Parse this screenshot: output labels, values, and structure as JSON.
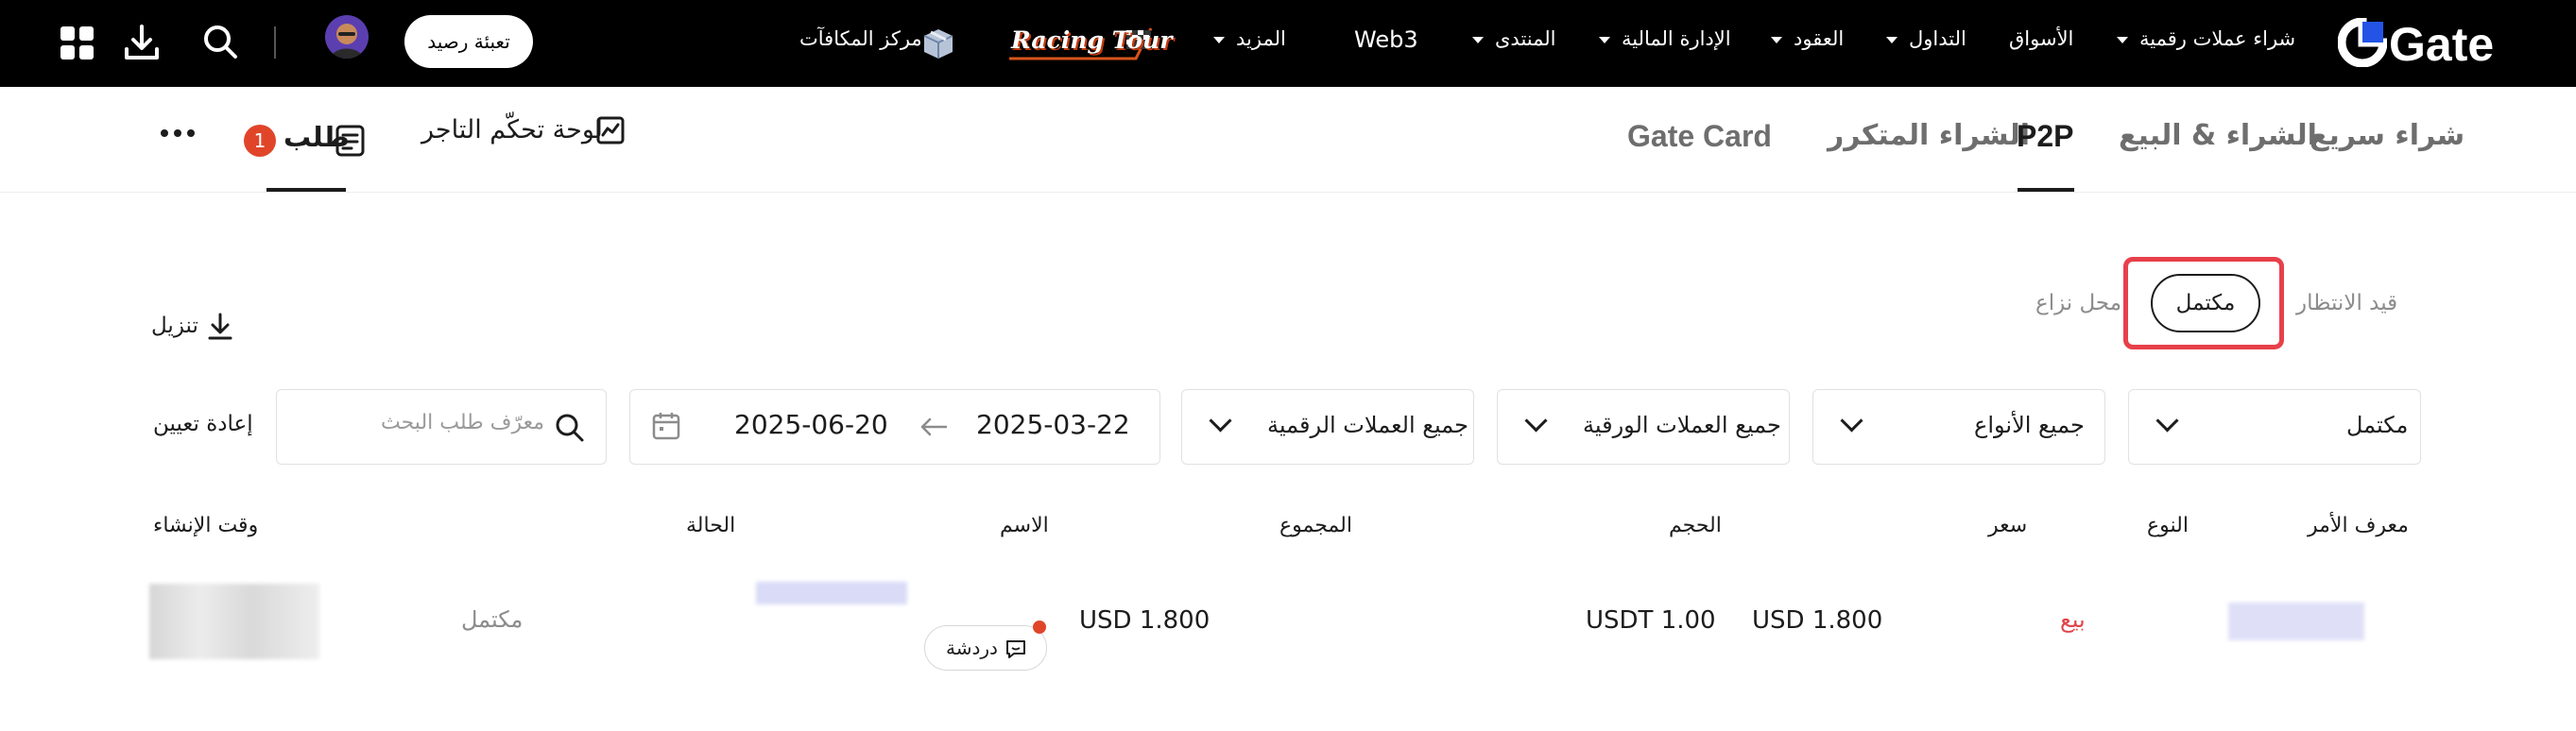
{
  "topnav": {
    "logo": "Gate",
    "items": [
      {
        "label": "شراء عملات رقمية",
        "dropdown": true
      },
      {
        "label": "الأسواق",
        "dropdown": false
      },
      {
        "label": "التداول",
        "dropdown": true
      },
      {
        "label": "العقود",
        "dropdown": true
      },
      {
        "label": "الإدارة المالية",
        "dropdown": true
      },
      {
        "label": "المنتدى",
        "dropdown": true
      },
      {
        "label": "Web3",
        "dropdown": false
      },
      {
        "label": "المزيد",
        "dropdown": true
      }
    ],
    "promo": "Racing Tour",
    "rewards": "مركز المكافآت",
    "topup_button": "تعبئة رصيد"
  },
  "subnav": {
    "tabs": [
      "شراء سريع",
      "الشراء & البيع",
      "P2P",
      "الشراء المتكرر",
      "Gate Card"
    ],
    "active_tab": "P2P",
    "merchant_dashboard": "لوحة تحكّم التاجر",
    "orders": "طلب",
    "orders_badge": "1"
  },
  "status_tabs": {
    "pending": "قيد الانتظار",
    "completed": "مكتمل",
    "disputed": "محل نزاع"
  },
  "download": "تنزيل",
  "filters": {
    "status": "مكتمل",
    "type": "جميع الأنواع",
    "fiat": "جميع العملات الورقية",
    "crypto": "جميع العملات الرقمية",
    "date_start": "2025-03-22",
    "date_end": "2025-06-20",
    "search_placeholder": "معرّف طلب البحث",
    "reset": "إعادة تعيين"
  },
  "table": {
    "columns": [
      "معرف الأمر",
      "النوع",
      "سعر",
      "الحجم",
      "المجموع",
      "الاسم",
      "الحالة",
      "وقت الإنشاء"
    ],
    "rows": [
      {
        "type": "بيع",
        "price": "USD 1.800",
        "volume": "USDT 1.00",
        "total": "USD 1.800",
        "chat": "دردشة",
        "status": "مكتمل"
      }
    ]
  },
  "colors": {
    "accent": "#2354e6",
    "sell": "#e0454a",
    "highlight": "#e8404a",
    "badge": "#e0452a"
  }
}
